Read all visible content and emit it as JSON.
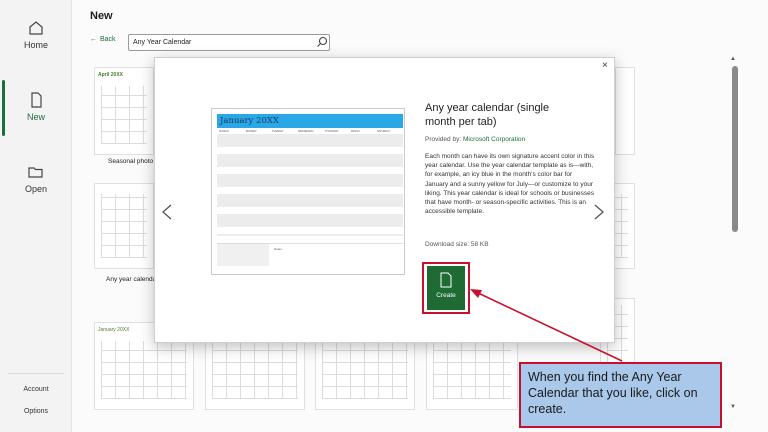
{
  "sidebar": {
    "items": [
      {
        "label": "Home",
        "icon": "home-icon"
      },
      {
        "label": "New",
        "icon": "new-document-icon"
      },
      {
        "label": "Open",
        "icon": "open-folder-icon"
      }
    ],
    "bottom": {
      "account": "Account",
      "options": "Options"
    }
  },
  "header": {
    "title": "New",
    "back_label": "Back"
  },
  "search": {
    "value": "Any Year Calendar"
  },
  "gallery": {
    "labels": [
      "Seasonal photo c",
      "Any year calenda"
    ],
    "thumb_titles": [
      "April 20XX",
      "January 20XX"
    ]
  },
  "modal": {
    "preview_heading": "January 20XX",
    "title": "Any year calendar (single month per tab)",
    "provided_by_label": "Provided by:",
    "provider": "Microsoft Corporation",
    "description": "Each month can have its own signature accent color in this year calendar. Use the year calendar template as is—with, for example, an icy blue in the month's color bar for January and a sunny yellow for July—or customize to your liking. This year calendar is ideal for schools or businesses that have month- or season-specific activities. This is an accessible template.",
    "download_size": "Download size: 58 KB",
    "create_label": "Create",
    "close_glyph": "×",
    "prev_glyph": "‹",
    "next_glyph": "›",
    "preview_dow": [
      "SUNDAY",
      "MONDAY",
      "TUESDAY",
      "WEDNESDAY",
      "THURSDAY",
      "FRIDAY",
      "SATURDAY"
    ],
    "preview_notes": "Notes"
  },
  "callout": {
    "text": "When you find the Any Year Calendar that you like, click on create."
  },
  "colors": {
    "accent": "#1b6e3a",
    "callout_fill": "#a9c8ea",
    "callout_border": "#c8102e",
    "preview_bar": "#2aa7e6"
  }
}
